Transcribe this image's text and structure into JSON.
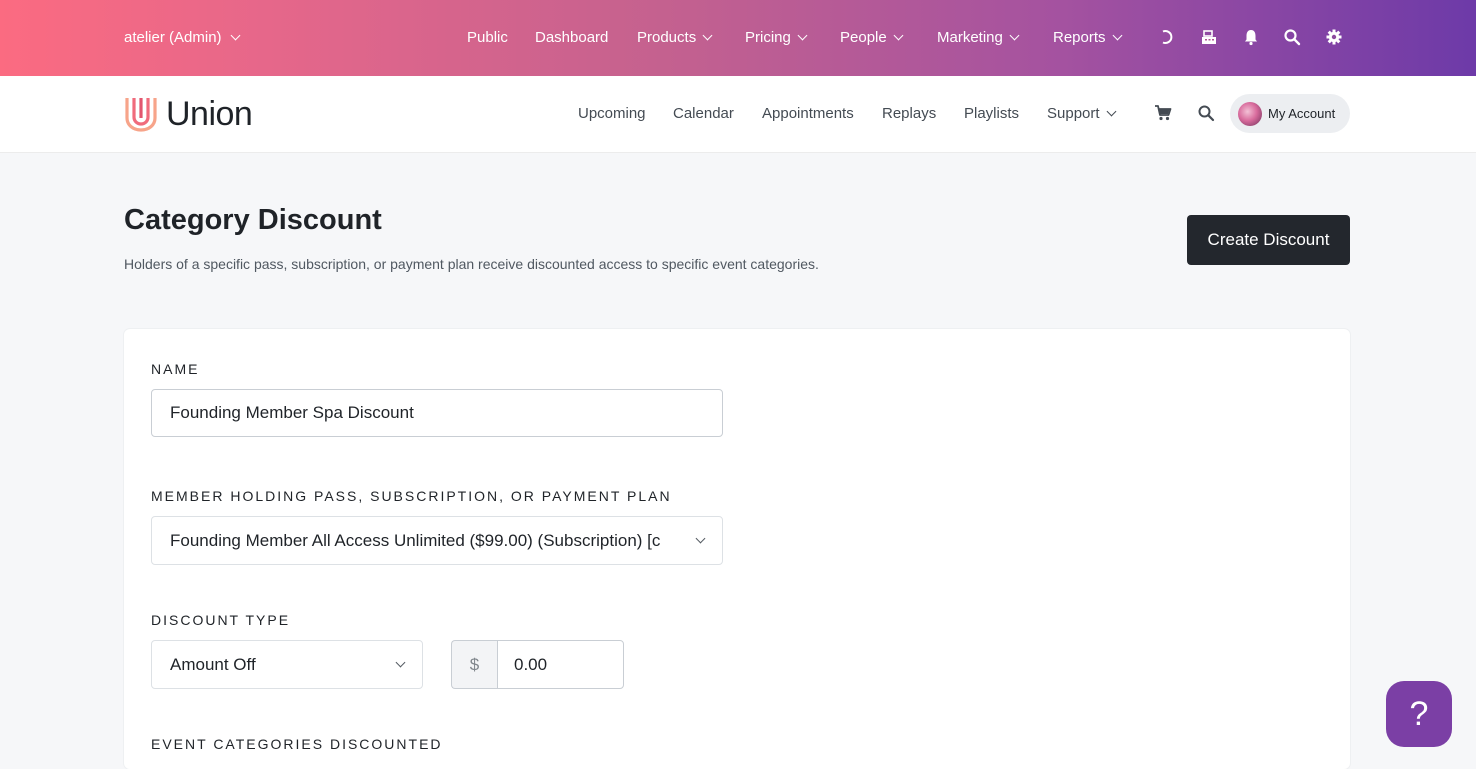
{
  "admin_bar": {
    "studio_switcher": "atelier (Admin)",
    "nav": [
      {
        "label": "Public"
      },
      {
        "label": "Dashboard"
      },
      {
        "label": "Products"
      },
      {
        "label": "Pricing"
      },
      {
        "label": "People"
      },
      {
        "label": "Marketing"
      },
      {
        "label": "Reports"
      }
    ],
    "icons": [
      "undo-icon",
      "register-icon",
      "bell-icon",
      "search-icon",
      "gear-icon"
    ]
  },
  "site_header": {
    "logo_text": "Union",
    "nav": [
      {
        "label": "Upcoming"
      },
      {
        "label": "Calendar"
      },
      {
        "label": "Appointments"
      },
      {
        "label": "Replays"
      },
      {
        "label": "Playlists"
      },
      {
        "label": "Support"
      }
    ],
    "icons": [
      "cart-icon",
      "search-icon"
    ],
    "account_label": "My Account"
  },
  "page": {
    "title": "Category Discount",
    "subtitle": "Holders of a specific pass, subscription, or payment plan receive discounted access to specific event categories.",
    "create_button": "Create Discount"
  },
  "form": {
    "name_label": "NAME",
    "name_value": "Founding Member Spa Discount",
    "plan_label": "MEMBER HOLDING PASS, SUBSCRIPTION, OR PAYMENT PLAN",
    "plan_value": "Founding Member All Access Unlimited ($99.00) (Subscription) [c",
    "discount_type_label": "DISCOUNT TYPE",
    "discount_type_value": "Amount Off",
    "amount_prefix": "$",
    "amount_value": "0.00",
    "categories_label": "EVENT CATEGORIES DISCOUNTED"
  },
  "help_button": "?",
  "colors": {
    "admin_gradient_start": "#fb6b81",
    "admin_gradient_end": "#6d3aa8",
    "primary_button": "#23272d",
    "help_button": "#7b3fa5"
  }
}
